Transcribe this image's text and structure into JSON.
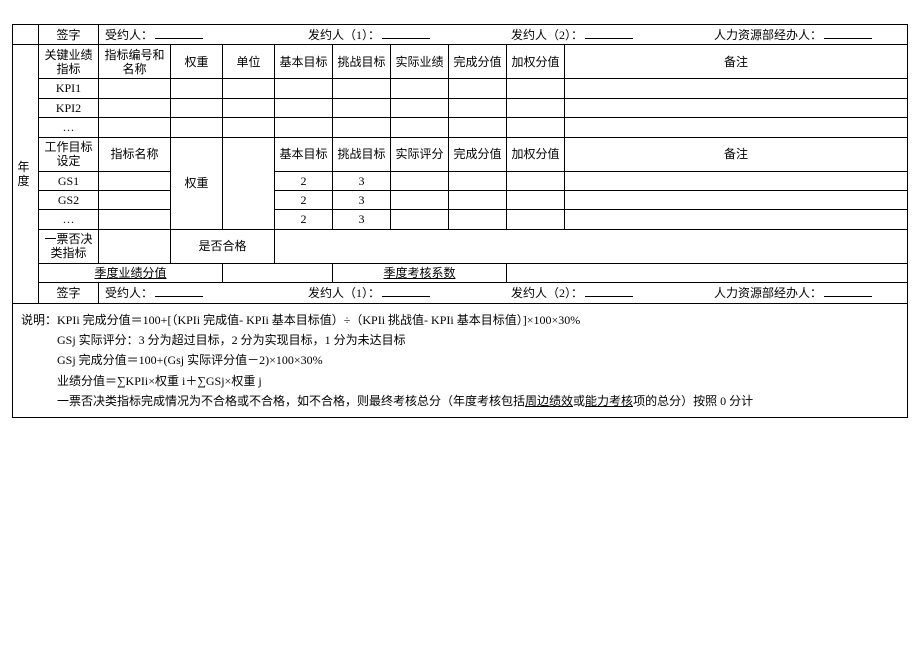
{
  "sig": {
    "label_sign": "签字",
    "receiver": "受约人：",
    "issuer1": "发约人（1）：",
    "issuer2": "发约人（2）：",
    "hr": "人力资源部经办人："
  },
  "headers": {
    "row_label_year": "年度",
    "kpi_header": "关键业绩指标",
    "code_name": "指标编号和名称",
    "weight": "权重",
    "unit": "单位",
    "base_target": "基本目标",
    "challenge_target": "挑战目标",
    "actual_perf": "实际业绩",
    "completion_score": "完成分值",
    "weighted_score": "加权分值",
    "remark": "备注",
    "gs_header": "工作目标设定",
    "indicator_name": "指标名称",
    "actual_rating": "实际评分",
    "veto_header": "一票否决类指标",
    "is_qualified": "是否合格",
    "quarter_score": "季度业绩分值",
    "quarter_coef": "季度考核系数"
  },
  "kpi_rows": {
    "r1": "KPI1",
    "r2": "KPI2",
    "r3": "…"
  },
  "gs_rows": {
    "r1": {
      "name": "GS1",
      "base": "2",
      "challenge": "3"
    },
    "r2": {
      "name": "GS2",
      "base": "2",
      "challenge": "3"
    },
    "r3": {
      "name": "…",
      "base": "2",
      "challenge": "3"
    }
  },
  "notes": {
    "label": "说明：",
    "l1a": "KPIi 完成分值＝100+[（KPIi 完成值- KPIi 基本目标值）÷（KPIi 挑战值- KPIi 基本目标值）]×100×30%",
    "l2": "GSj 实际评分：3 分为超过目标，2 分为实现目标，1 分为未达目标",
    "l3": "GSj 完成分值＝100+(Gsj 实际评分值－2)×100×30%",
    "l4": "业绩分值＝∑KPIi×权重 i＋∑GSj×权重 j",
    "l5a": "一票否决类指标完成情况为不合格或不合格，如不合格，则最终考核总分（年度考核包括",
    "l5u1": "周边绩效",
    "l5b": "或",
    "l5u2": "能力考核",
    "l5c": "项的总分）按照 0 分计"
  }
}
